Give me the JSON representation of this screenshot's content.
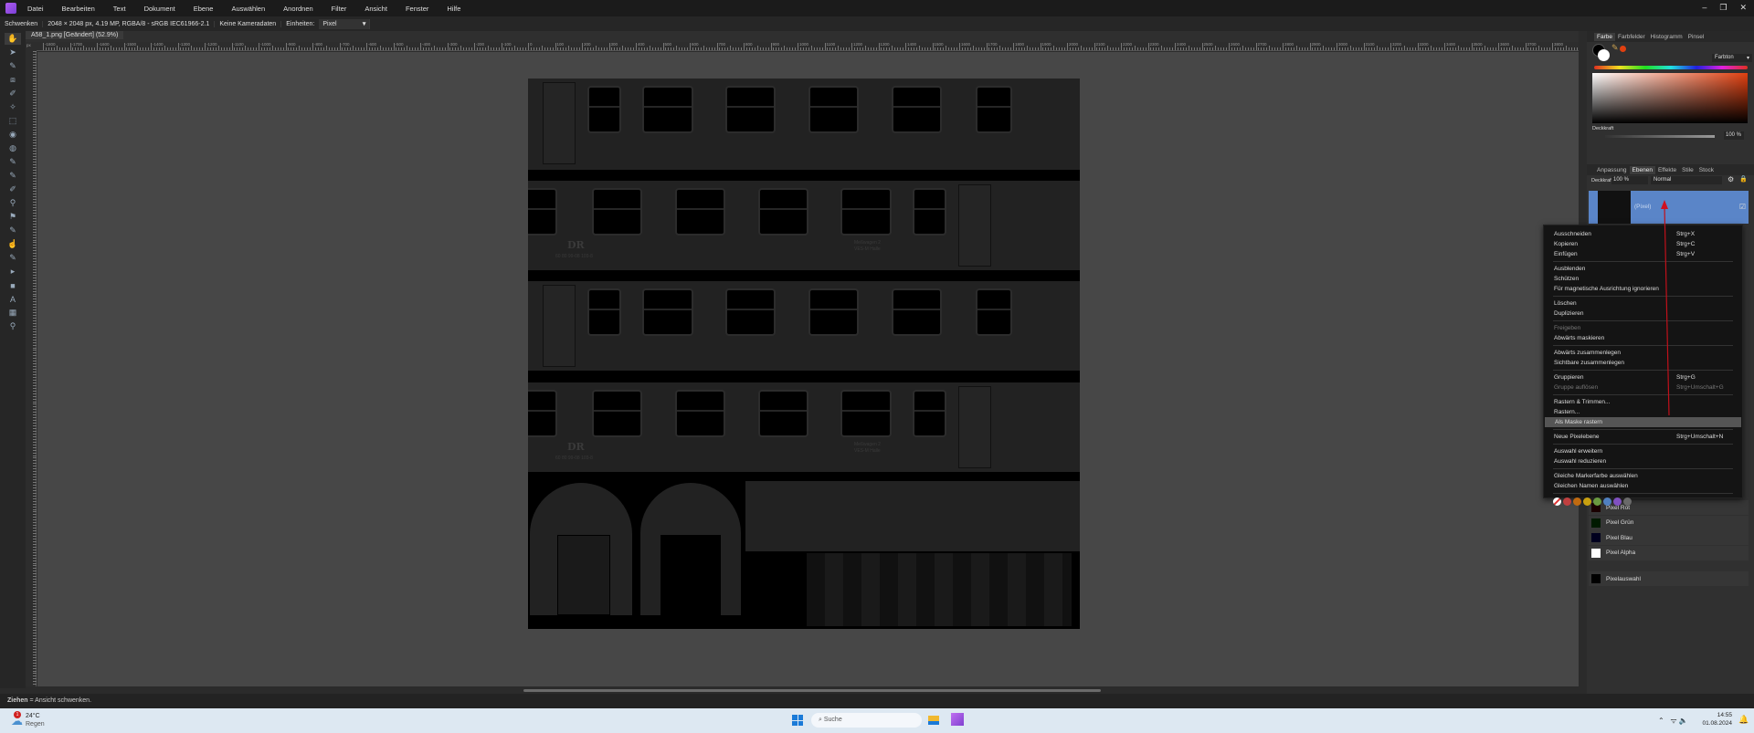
{
  "app": {
    "menu": [
      "Datei",
      "Bearbeiten",
      "Text",
      "Dokument",
      "Ebene",
      "Auswählen",
      "Anordnen",
      "Filter",
      "Ansicht",
      "Fenster",
      "Hilfe"
    ],
    "window_controls": [
      "–",
      "❐",
      "✕"
    ]
  },
  "context_toolbar": {
    "tool": "Schwenken",
    "doc_info": "2048 × 2048 px, 4.19 MP, RGBA/8 - sRGB IEC61966-2.1",
    "camera": "Keine Kameradaten",
    "units_label": "Einheiten:",
    "units_value": "Pixel"
  },
  "document": {
    "tab": "A58_1.png [Geändert] (52.9%)",
    "ruler_unit": "px",
    "ruler_labels": [
      -1800,
      -1700,
      -1600,
      -1500,
      -1400,
      -1300,
      -1200,
      -1100,
      -1000,
      -900,
      -800,
      -700,
      -600,
      -500,
      -400,
      -300,
      -200,
      -100,
      0,
      100,
      200,
      300,
      400,
      500,
      600,
      700,
      800,
      900,
      1000,
      1100,
      1200,
      1300,
      1400,
      1500,
      1600,
      1700,
      1800,
      1900,
      2000,
      2100,
      2200,
      2300,
      2400,
      2500,
      2600,
      2700,
      2800,
      2900,
      3000,
      3100,
      3200,
      3300,
      3400,
      3500,
      3600,
      3700,
      3800
    ],
    "image_text": {
      "logo": "DR",
      "number": "60 80 99-08 103-8",
      "label1": "Meßwagen 2",
      "label2": "VES-M Halle"
    }
  },
  "tools": [
    "hand",
    "move",
    "color-picker",
    "crop",
    "selection-brush",
    "flood-select",
    "marquee",
    "fill",
    "gradient",
    "paint-brush",
    "color-replacement",
    "erase",
    "dodge",
    "clone",
    "healing",
    "smudge",
    "sharpen",
    "node",
    "rectangle",
    "text",
    "mesh",
    "zoom"
  ],
  "color_panel": {
    "tabs": [
      "Farbe",
      "Farbfelder",
      "Histogramm",
      "Pinsel"
    ],
    "active": "Farbe",
    "mode": "Farbton",
    "opacity_label": "Deckkraft",
    "opacity_value": "100 %",
    "accent": "#e04010"
  },
  "layers_panel": {
    "tabs": [
      "Anpassung",
      "Ebenen",
      "Effekte",
      "Stile",
      "Stock"
    ],
    "active": "Ebenen",
    "opacity_label": "Deckkraft:",
    "opacity_value": "100 %",
    "blend_mode": "Normal",
    "selected_layer": "(Pixel)",
    "selected_color": "#5a85c8",
    "channels": [
      {
        "name": "Pixel Rot",
        "color": "#1a0000"
      },
      {
        "name": "Pixel Grün",
        "color": "#001a00"
      },
      {
        "name": "Pixel Blau",
        "color": "#00001e"
      },
      {
        "name": "Pixel Alpha",
        "color": "#ffffff"
      }
    ],
    "selection_channel": "Pixelauswahl"
  },
  "context_menu": {
    "groups": [
      [
        {
          "label": "Ausschneiden",
          "shortcut": "Strg+X"
        },
        {
          "label": "Kopieren",
          "shortcut": "Strg+C"
        },
        {
          "label": "Einfügen",
          "shortcut": "Strg+V"
        }
      ],
      [
        {
          "label": "Ausblenden"
        },
        {
          "label": "Schützen"
        },
        {
          "label": "Für magnetische Ausrichtung ignorieren"
        }
      ],
      [
        {
          "label": "Löschen"
        },
        {
          "label": "Duplizieren"
        }
      ],
      [
        {
          "label": "Freigeben",
          "disabled": true
        },
        {
          "label": "Abwärts maskieren"
        }
      ],
      [
        {
          "label": "Abwärts zusammenlegen"
        },
        {
          "label": "Sichtbare zusammenlegen"
        }
      ],
      [
        {
          "label": "Gruppieren",
          "shortcut": "Strg+G"
        },
        {
          "label": "Gruppe auflösen",
          "shortcut": "Strg+Umschalt+G",
          "disabled": true
        }
      ],
      [
        {
          "label": "Rastern & Trimmen..."
        },
        {
          "label": "Rastern..."
        },
        {
          "label": "Als Maske rastern",
          "highlighted": true
        }
      ],
      [
        {
          "label": "Neue Pixelebene",
          "shortcut": "Strg+Umschalt+N"
        }
      ],
      [
        {
          "label": "Auswahl erweitern"
        },
        {
          "label": "Auswahl reduzieren"
        }
      ],
      [
        {
          "label": "Gleiche Markerfarbe auswählen"
        },
        {
          "label": "Gleichen Namen auswählen"
        }
      ]
    ],
    "marker_colors": [
      "none",
      "#c04040",
      "#c06a10",
      "#c8a010",
      "#6a9a40",
      "#5080c0",
      "#8050c0",
      "#6a6a6a"
    ]
  },
  "status": {
    "bold": "Ziehen",
    "text": " = Ansicht schwenken."
  },
  "taskbar": {
    "weather_temp": "24°C",
    "weather_text": "Regen",
    "weather_badge": "1",
    "search": "Suche",
    "time": "14:55",
    "date": "01.08.2024"
  }
}
